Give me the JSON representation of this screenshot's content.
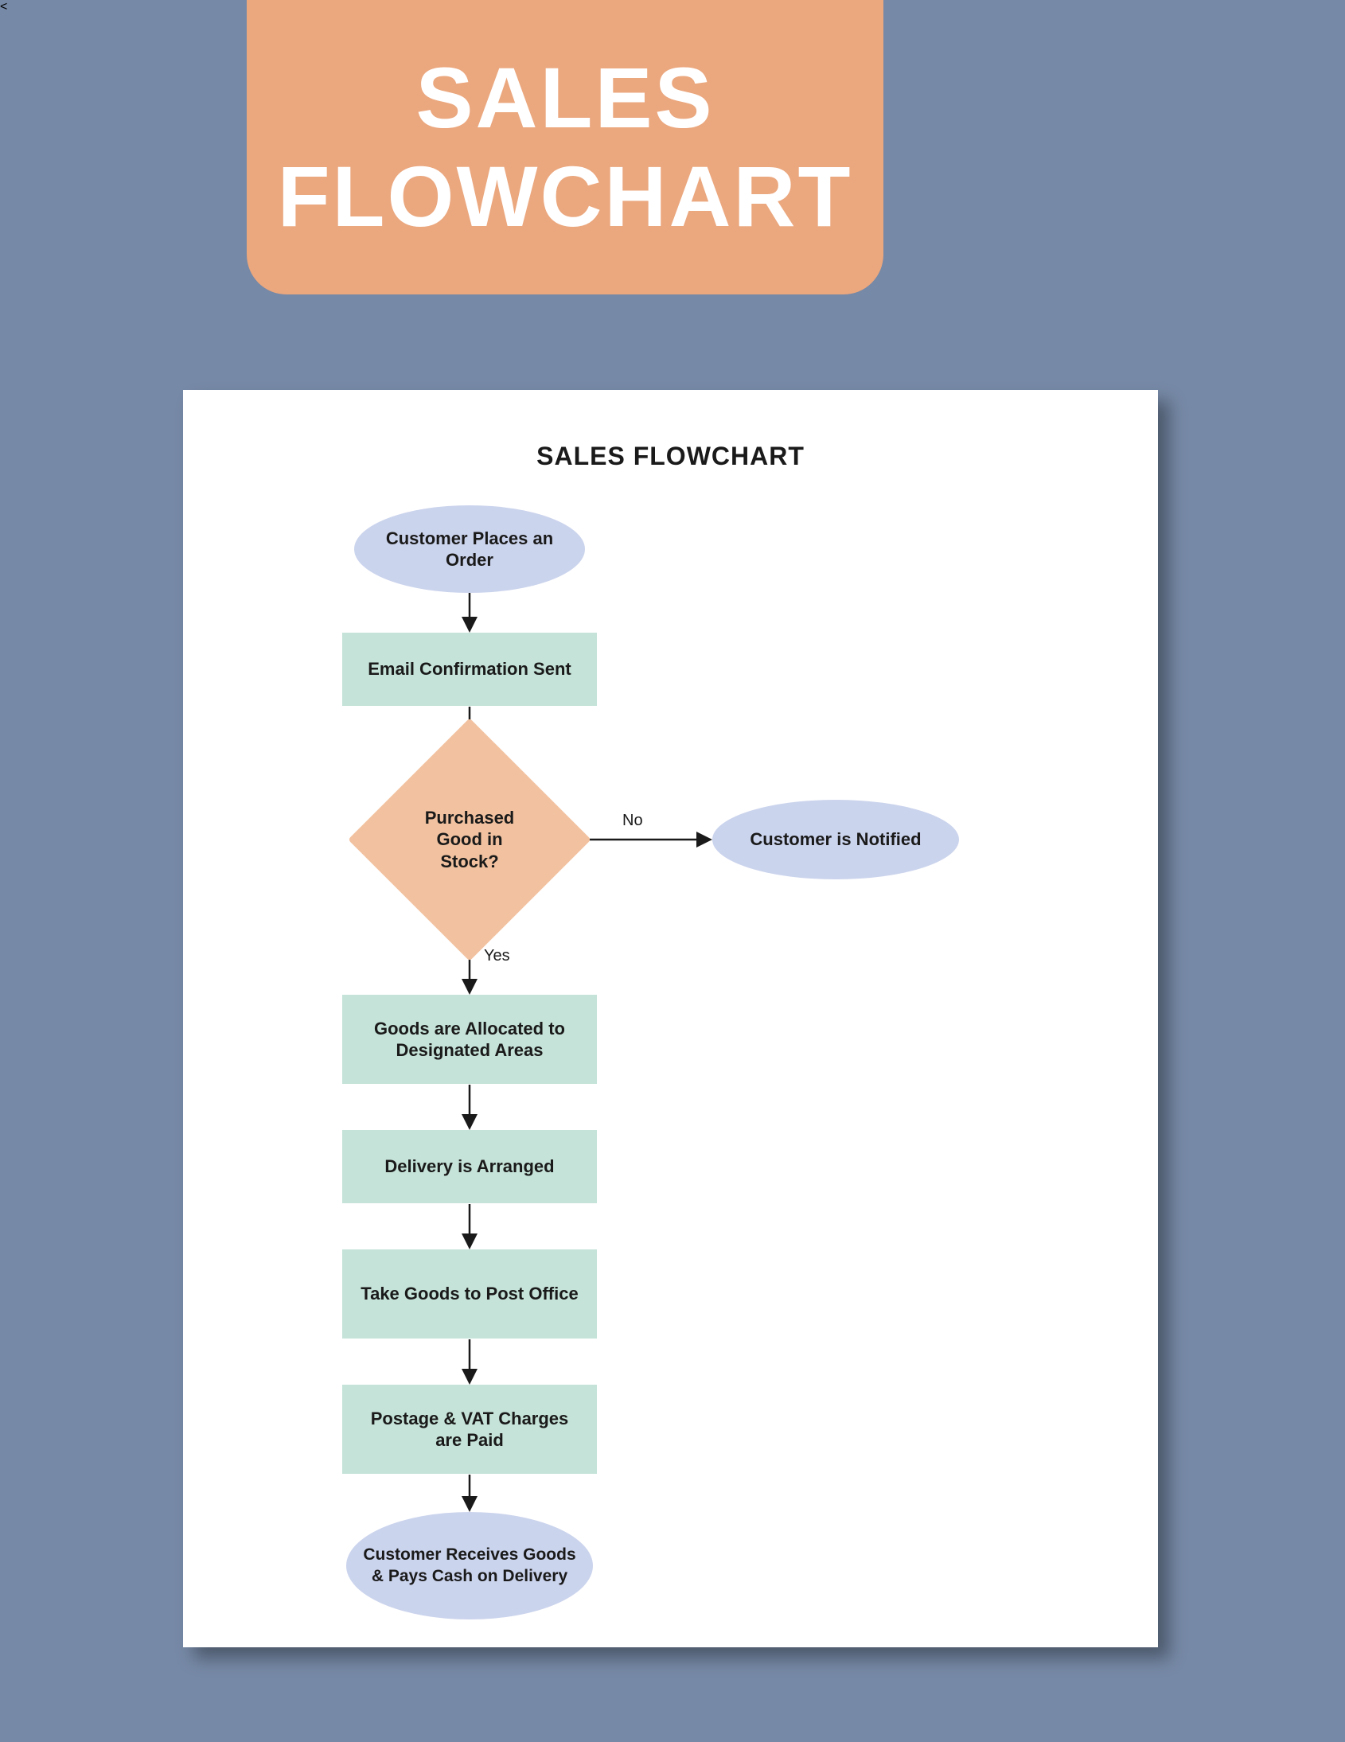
{
  "banner": {
    "title": "SALES FLOWCHART"
  },
  "page": {
    "title": "SALES FLOWCHART"
  },
  "nodes": {
    "start": "Customer Places an Order",
    "email": "Email Confirmation Sent",
    "decision": "Purchased Good in Stock?",
    "notify": "Customer is Notified",
    "allocate": "Goods are Allocated to Designated Areas",
    "delivery": "Delivery is Arranged",
    "post": "Take Goods to Post Office",
    "postage": "Postage & VAT Charges are Paid",
    "end": "Customer Receives Goods & Pays Cash on Delivery"
  },
  "labels": {
    "no": "No",
    "yes": "Yes"
  },
  "chart_data": {
    "type": "flowchart",
    "title": "SALES FLOWCHART",
    "nodes": [
      {
        "id": "start",
        "type": "terminator",
        "label": "Customer Places an Order"
      },
      {
        "id": "email",
        "type": "process",
        "label": "Email Confirmation Sent"
      },
      {
        "id": "decision",
        "type": "decision",
        "label": "Purchased Good in Stock?"
      },
      {
        "id": "notify",
        "type": "terminator",
        "label": "Customer is Notified"
      },
      {
        "id": "allocate",
        "type": "process",
        "label": "Goods are Allocated to Designated Areas"
      },
      {
        "id": "delivery",
        "type": "process",
        "label": "Delivery is Arranged"
      },
      {
        "id": "post",
        "type": "process",
        "label": "Take Goods to Post Office"
      },
      {
        "id": "postage",
        "type": "process",
        "label": "Postage & VAT Charges are Paid"
      },
      {
        "id": "end",
        "type": "terminator",
        "label": "Customer Receives Goods & Pays Cash on Delivery"
      }
    ],
    "edges": [
      {
        "from": "start",
        "to": "email"
      },
      {
        "from": "email",
        "to": "decision"
      },
      {
        "from": "decision",
        "to": "notify",
        "label": "No"
      },
      {
        "from": "decision",
        "to": "allocate",
        "label": "Yes"
      },
      {
        "from": "allocate",
        "to": "delivery"
      },
      {
        "from": "delivery",
        "to": "post"
      },
      {
        "from": "post",
        "to": "postage"
      },
      {
        "from": "postage",
        "to": "end"
      }
    ]
  }
}
